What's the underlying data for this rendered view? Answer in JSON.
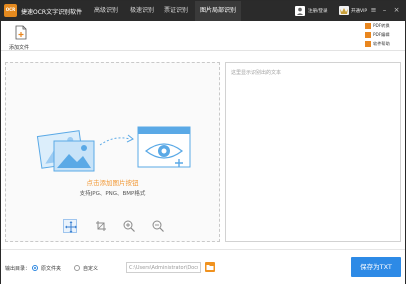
{
  "app": {
    "logo_text": "OCR",
    "title": "捷速OCR文字识别软件"
  },
  "tabs": [
    {
      "label": "高级识别",
      "active": false
    },
    {
      "label": "极速识别",
      "active": false
    },
    {
      "label": "票证识别",
      "active": false
    },
    {
      "label": "图片局部识别",
      "active": true
    }
  ],
  "header": {
    "user_text": "注册/登录",
    "vip_text": "开通VIP"
  },
  "toolbar": {
    "add_file_label": "添加文件",
    "side_buttons": [
      "PDF转换",
      "PDF编辑",
      "软件帮助"
    ]
  },
  "workspace": {
    "primary_text": "点击添加图片按钮",
    "secondary_text": "支持JPG、PNG、BMP格式",
    "right_placeholder": "这里显示识别出的文本"
  },
  "bottom": {
    "output_label": "输出目录：",
    "radio_original": "原文件夹",
    "radio_custom": "自定义",
    "path_value": "C:\\Users\\Administrator\\Documents",
    "save_button": "保存为TXT"
  },
  "colors": {
    "accent_orange": "#e9861e",
    "primary_blue": "#2d8ae6",
    "illustration_blue": "#5aa9e6"
  }
}
